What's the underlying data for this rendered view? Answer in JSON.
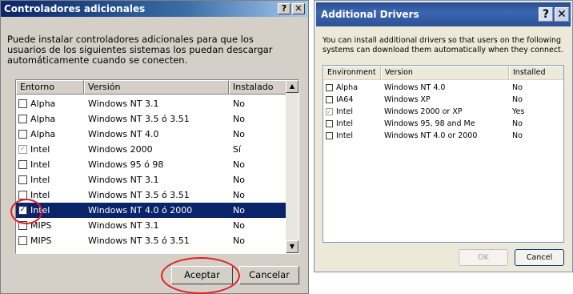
{
  "es_dialog": {
    "title": "Controladores adicionales",
    "help_btn": "?",
    "close_btn": "✕",
    "description": "Puede instalar controladores adicionales para que los usuarios de los siguientes sistemas los puedan descargar automáticamente cuando se conecten.",
    "columns": [
      "Entorno",
      "Versión",
      "Instalado"
    ],
    "rows": [
      {
        "env": "Alpha",
        "version": "Windows NT 3.1",
        "installed": "No",
        "checked": false,
        "disabled": false
      },
      {
        "env": "Alpha",
        "version": "Windows NT 3.5 ó 3.51",
        "installed": "No",
        "checked": false,
        "disabled": false
      },
      {
        "env": "Alpha",
        "version": "Windows NT 4.0",
        "installed": "No",
        "checked": false,
        "disabled": false
      },
      {
        "env": "Intel",
        "version": "Windows 2000",
        "installed": "Sí",
        "checked": true,
        "disabled": true
      },
      {
        "env": "Intel",
        "version": "Windows 95 ó 98",
        "installed": "No",
        "checked": false,
        "disabled": false
      },
      {
        "env": "Intel",
        "version": "Windows NT 3.1",
        "installed": "No",
        "checked": false,
        "disabled": false
      },
      {
        "env": "Intel",
        "version": "Windows NT 3.5 ó 3.51",
        "installed": "No",
        "checked": false,
        "disabled": false
      },
      {
        "env": "Intel",
        "version": "Windows NT 4.0 ó 2000",
        "installed": "No",
        "checked": true,
        "disabled": false,
        "selected": true
      },
      {
        "env": "MIPS",
        "version": "Windows NT 3.1",
        "installed": "No",
        "checked": false,
        "disabled": false
      },
      {
        "env": "MIPS",
        "version": "Windows NT 3.5 ó 3.51",
        "installed": "No",
        "checked": false,
        "disabled": false
      }
    ],
    "ok_label": "Aceptar",
    "cancel_label": "Cancelar"
  },
  "en_dialog": {
    "title": "Additional Drivers",
    "help_btn": "?",
    "close_btn": "✕",
    "description": "You can install additional drivers so that users on the following systems can download them automatically when they connect.",
    "columns": [
      "Environment",
      "Version",
      "Installed"
    ],
    "rows": [
      {
        "env": "Alpha",
        "version": "Windows NT 4.0",
        "installed": "No",
        "checked": false,
        "disabled": false
      },
      {
        "env": "IA64",
        "version": "Windows XP",
        "installed": "No",
        "checked": false,
        "disabled": false
      },
      {
        "env": "Intel",
        "version": "Windows 2000 or XP",
        "installed": "Yes",
        "checked": true,
        "disabled": true
      },
      {
        "env": "Intel",
        "version": "Windows 95, 98 and Me",
        "installed": "No",
        "checked": false,
        "disabled": false
      },
      {
        "env": "Intel",
        "version": "Windows NT 4.0 or 2000",
        "installed": "No",
        "checked": false,
        "disabled": false
      }
    ],
    "ok_label": "OK",
    "cancel_label": "Cancel"
  },
  "colors": {
    "highlight_ring": "#e02020",
    "selection": "#0a246a"
  }
}
